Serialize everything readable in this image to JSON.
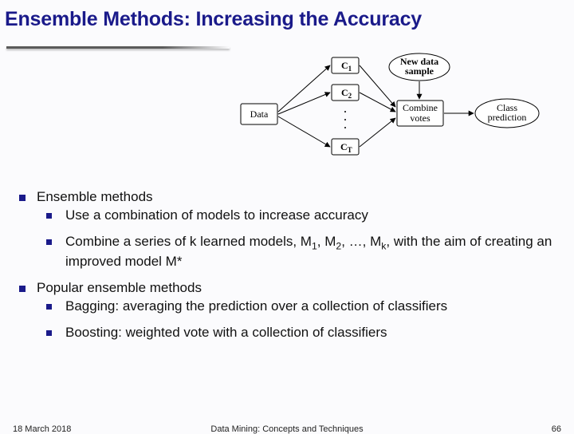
{
  "title": "Ensemble Methods: Increasing the Accuracy",
  "diagram": {
    "data": "Data",
    "c1": "C",
    "c1s": "1",
    "c2": "C",
    "c2s": "2",
    "ct": "C",
    "cts": "T",
    "newdata1": "New data",
    "newdata2": "sample",
    "combine1": "Combine",
    "combine2": "votes",
    "pred1": "Class",
    "pred2": "prediction"
  },
  "bullets": {
    "b1": "Ensemble methods",
    "b1a": "Use a combination of models to increase accuracy",
    "b1b_pre": "Combine a series of k learned models, M",
    "b1b_s1": "1",
    "b1b_mid1": ", M",
    "b1b_s2": "2",
    "b1b_mid2": ", …, M",
    "b1b_s3": "k",
    "b1b_post": ", with the aim of creating an improved model M*",
    "b2": "Popular ensemble methods",
    "b2a": "Bagging: averaging the prediction over a collection of classifiers",
    "b2b": "Boosting: weighted vote with a collection of classifiers"
  },
  "footer": {
    "date": "18 March 2018",
    "mid": "Data Mining: Concepts and Techniques",
    "num": "66"
  }
}
